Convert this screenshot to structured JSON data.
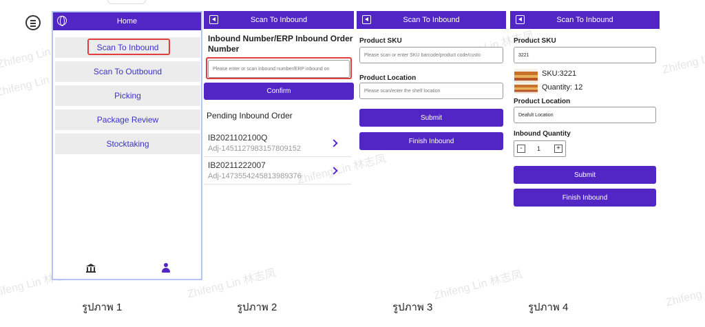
{
  "screen1": {
    "title": "Home",
    "menu": [
      "Scan To Inbound",
      "Scan To Outbound",
      "Picking",
      "Package Review",
      "Stocktaking"
    ]
  },
  "screen2": {
    "title": "Scan To Inbound",
    "heading": "Inbound Number/ERP Inbound Order Number",
    "input_placeholder": "Please enter or scan inbound number/ERP inbound on",
    "confirm_label": "Confirm",
    "pending_heading": "Pending Inbound Order",
    "orders": [
      {
        "number": "IB2021102100Q",
        "ref": "Adj-1451127983157809152"
      },
      {
        "number": "IB20211222007",
        "ref": "Adj-1473554245813989376"
      }
    ]
  },
  "screen3": {
    "title": "Scan To Inbound",
    "sku_label": "Product SKU",
    "sku_placeholder": "Please scan or enter SKU barcode/product code/custo",
    "location_label": "Product Location",
    "location_placeholder": "Please scan/enter the shelf location",
    "submit_label": "Submit",
    "finish_label": "Finish Inbound"
  },
  "screen4": {
    "title": "Scan To Inbound",
    "sku_label": "Product SKU",
    "sku_value": "3221",
    "product_sku": "SKU:3221",
    "product_quantity": "Quantity: 12",
    "location_label": "Product Location",
    "location_value": "Deafult Location",
    "qty_label": "Inbound Quantity",
    "qty_minus": "-",
    "qty_value": "1",
    "qty_plus": "+",
    "submit_label": "Submit",
    "finish_label": "Finish Inbound"
  },
  "captions": [
    "รูปภาพ 1",
    "รูปภาพ 2",
    "รูปภาพ 3",
    "รูปภาพ 4"
  ],
  "watermark": "Zhifeng Lin 林志凤",
  "colors": {
    "accent": "#5226c5",
    "highlight": "#e23c3c",
    "frame": "#b3c4f6"
  }
}
